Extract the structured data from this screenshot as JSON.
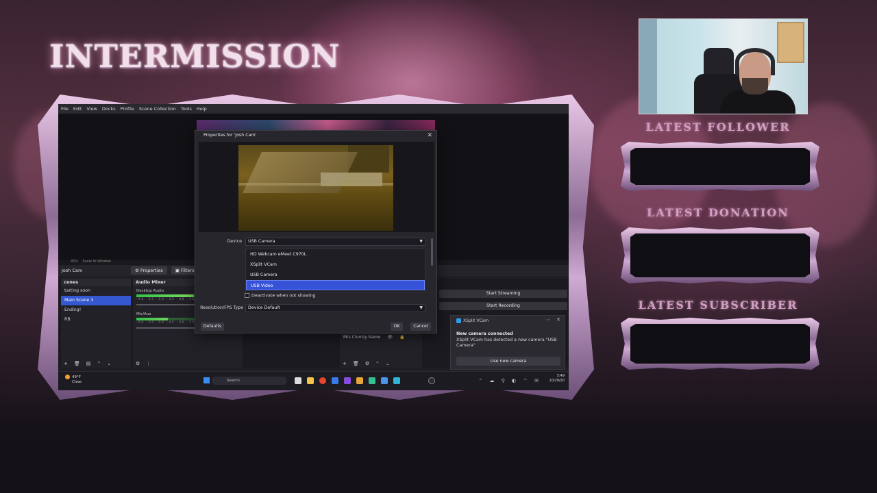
{
  "overlay": {
    "title": "INTERMISSION",
    "latest_follower": "LATEST FOLLOWER",
    "latest_donation": "LATEST DONATION",
    "latest_subscriber": "LATEST SUBSCRIBER"
  },
  "obs": {
    "menu": [
      "File",
      "Edit",
      "View",
      "Docks",
      "Profile",
      "Scene Collection",
      "Tools",
      "Help"
    ],
    "preview_zoom": "45%",
    "scale_mode": "Scale to Window",
    "selected_source": "Josh Cam",
    "properties_button": "Properties",
    "filters_button": "Filters",
    "scenes_title": "cenes",
    "scenes": [
      "tarting soon",
      "Main Scene 3",
      "Ending!",
      "RB"
    ],
    "audio_mixer_title": "Audio Mixer",
    "channels": [
      {
        "name": "Desktop Audio",
        "level": 0.55
      },
      {
        "name": "Mic/Aux",
        "level": 0.3
      }
    ],
    "meter_ticks": "-60 -55 -50 -45 -40 -35 -30",
    "source_row_name": "Mrs.Clumzy Name",
    "start_streaming": "Start Streaming",
    "start_recording": "Start Recording"
  },
  "props_dialog": {
    "title": "Properties for 'Josh Cam'",
    "device_label": "Device",
    "device_value": "USB Camera",
    "device_options": [
      "HD Webcam eMeet C970L",
      "XSplit VCam",
      "USB Camera",
      "USB Video"
    ],
    "highlighted_option": "USB Video",
    "deactivate_label": "Deactivate when not showing",
    "res_fps_label": "Resolution/FPS Type",
    "res_fps_value": "Device Default",
    "defaults_button": "Defaults",
    "ok_button": "OK",
    "cancel_button": "Cancel"
  },
  "notification": {
    "app": "XSplit VCam",
    "heading": "New camera connected",
    "message": "XSplit VCam has detected a new camera \"USB Camera\"",
    "button": "Use new camera"
  },
  "taskbar": {
    "temperature": "49°F",
    "condition": "Clear",
    "search_placeholder": "Search",
    "time": "5:49",
    "date": "10/29/20"
  },
  "colors": {
    "accent": "#3652d8",
    "frame": "#cfaad3"
  }
}
